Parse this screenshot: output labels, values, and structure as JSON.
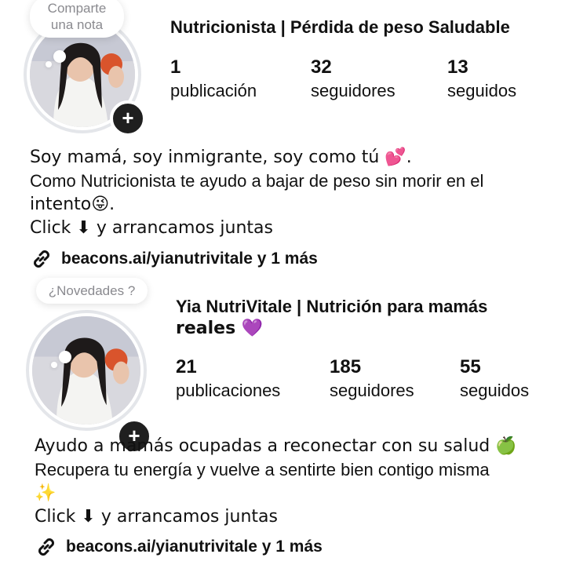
{
  "profiles": [
    {
      "note": "Comparte una nota",
      "name": "Nutricionista | Pérdida de peso Saludable",
      "stats": [
        {
          "value": "1",
          "label": "publicación"
        },
        {
          "value": "32",
          "label": "seguidores"
        },
        {
          "value": "13",
          "label": "seguidos"
        }
      ],
      "bio": [
        "Soy mamá, soy inmigrante, soy como tú 💕.",
        "Como Nutricionista te ayudo a bajar de peso sin morir en el",
        "intento😜.",
        "Click ⬇ y arrancamos juntas"
      ],
      "link": "beacons.ai/yianutrivitale y 1 más",
      "plus": "+"
    },
    {
      "note": "¿Novedades ?",
      "name_line1": "Yia NutriVitale | Nutrición para mamás",
      "name_line2": "reales 💜",
      "stats": [
        {
          "value": "21",
          "label": "publicaciones"
        },
        {
          "value": "185",
          "label": "seguidores"
        },
        {
          "value": "55",
          "label": "seguidos"
        }
      ],
      "bio": [
        "Ayudo a mamás ocupadas a reconectar con su salud 🍏",
        "Recupera tu energía y vuelve a sentirte bien contigo misma",
        "✨",
        "Click ⬇ y arrancamos juntas"
      ],
      "link": "beacons.ai/yianutrivitale y 1 más",
      "plus": "+"
    }
  ],
  "icons": {
    "link": "link-chain-icon",
    "plus": "plus-icon",
    "arrow": "down-arrow-emoji"
  }
}
